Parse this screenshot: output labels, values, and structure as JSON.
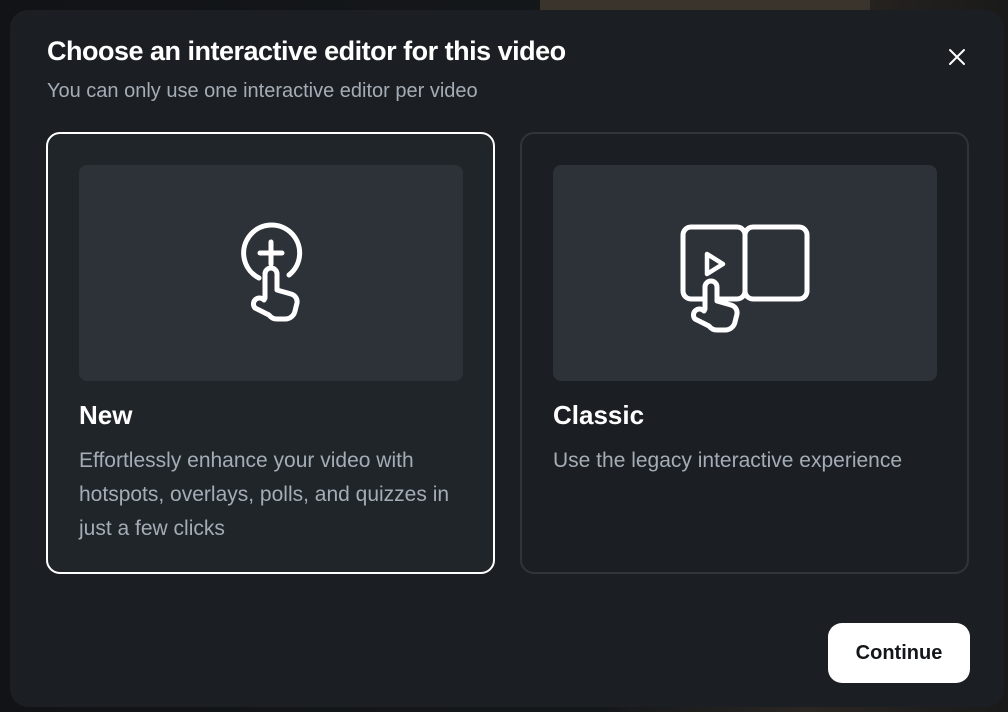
{
  "dialog": {
    "title": "Choose an interactive editor for this video",
    "subtitle": "You can only use one interactive editor per video",
    "close_icon": "close-icon"
  },
  "options": [
    {
      "title": "New",
      "description": "Effortlessly enhance your video with hotspots, overlays, polls, and quizzes in just a few clicks",
      "icon": "add-tap-icon",
      "selected": true
    },
    {
      "title": "Classic",
      "description": "Use the legacy interactive experience",
      "icon": "video-panel-tap-icon",
      "selected": false
    }
  ],
  "footer": {
    "continue_label": "Continue"
  },
  "colors": {
    "modal_bg": "#1b1f23",
    "preview_bg": "#2c3238",
    "selected_border": "#ffffff",
    "muted_text": "#a4acb5"
  }
}
